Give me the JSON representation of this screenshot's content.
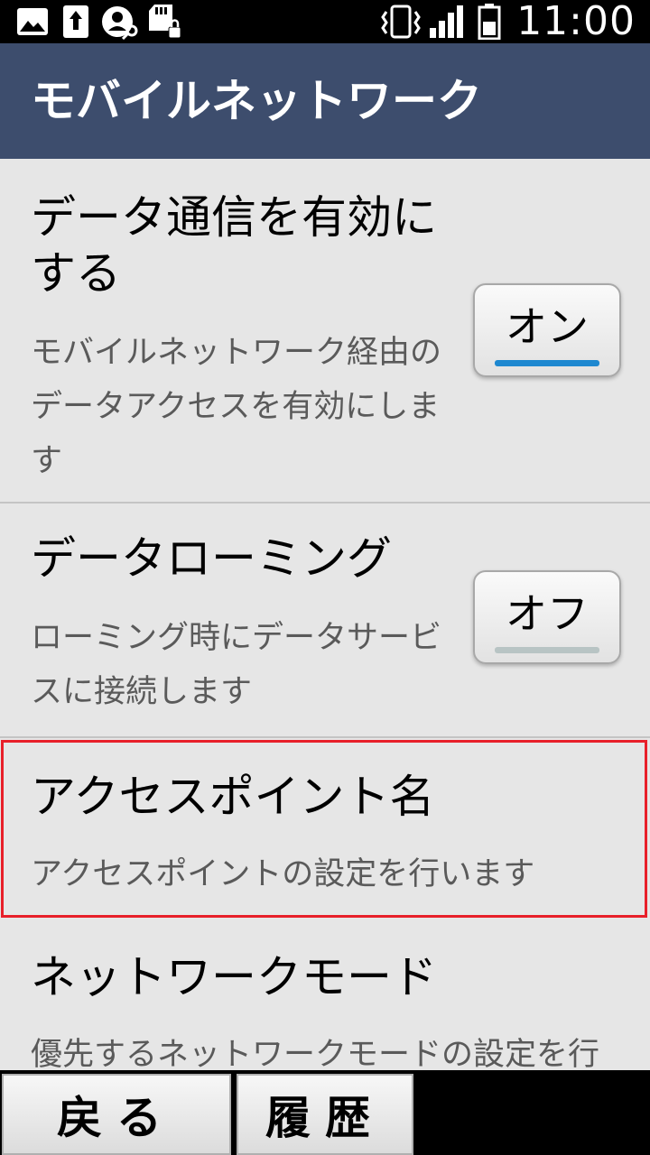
{
  "status_bar": {
    "time": "11:00",
    "icons": [
      "image-icon",
      "upload-icon",
      "account-key-icon",
      "sd-lock-icon",
      "vibrate-icon",
      "signal-icon",
      "battery-icon"
    ]
  },
  "header": {
    "title": "モバイルネットワーク"
  },
  "settings": {
    "data_enabled": {
      "title_line1": "データ通信を有効に",
      "title_line2": "する",
      "summary_line1": "モバイルネットワーク経由の",
      "summary_line2": "データアクセスを有効にしま",
      "summary_line3": "す",
      "toggle_label": "オン",
      "toggle_state": "on"
    },
    "data_roaming": {
      "title": "データローミング",
      "summary_line1": "ローミング時にデータサービ",
      "summary_line2": "スに接続します",
      "toggle_label": "オフ",
      "toggle_state": "off"
    },
    "access_point": {
      "title": "アクセスポイント名",
      "summary": "アクセスポイントの設定を行います"
    },
    "network_mode": {
      "title": "ネットワークモード",
      "summary": "優先するネットワークモードの設定を行"
    }
  },
  "softkeys": {
    "back": "戻る",
    "history": "履歴"
  },
  "colors": {
    "header_bg": "#3d4d6d",
    "toggle_on_bar": "#1e88d0",
    "toggle_off_bar": "#b8c4c4",
    "highlight": "#e8202a"
  }
}
